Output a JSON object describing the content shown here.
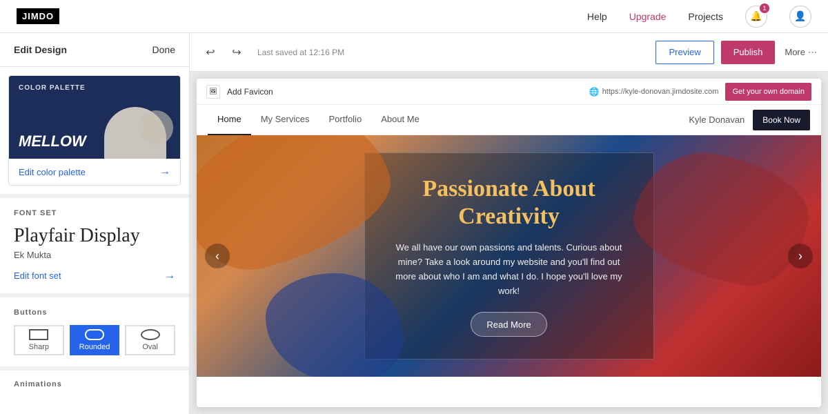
{
  "topnav": {
    "logo": "JIMDO",
    "help": "Help",
    "upgrade": "Upgrade",
    "projects": "Projects",
    "notification_count": "1"
  },
  "left_panel": {
    "header_title": "Edit Design",
    "done_label": "Done",
    "color_palette": {
      "section_label": "COLOR PALETTE",
      "palette_name": "MELLOW",
      "edit_link": "Edit color palette"
    },
    "font_set": {
      "section_label": "FONT SET",
      "primary_font": "Playfair Display",
      "secondary_font": "Ek Mukta",
      "edit_link": "Edit font set"
    },
    "buttons": {
      "section_label": "Buttons",
      "options": [
        {
          "id": "sharp",
          "label": "Sharp",
          "active": false
        },
        {
          "id": "rounded",
          "label": "Rounded",
          "active": true
        },
        {
          "id": "oval",
          "label": "Oval",
          "active": false
        }
      ]
    },
    "animations": {
      "section_label": "Animations"
    }
  },
  "preview_toolbar": {
    "saved_text": "Last saved at 12:16 PM",
    "preview_label": "Preview",
    "publish_label": "Publish",
    "more_label": "More"
  },
  "website": {
    "add_favicon": "Add Favicon",
    "site_url": "https://kyle-donovan.jimdosite.com",
    "get_domain": "Get your own domain",
    "nav_items": [
      "Home",
      "My Services",
      "Portfolio",
      "About Me"
    ],
    "nav_name": "Kyle Donavan",
    "book_now": "Book Now",
    "hero_title": "Passionate About Creativity",
    "hero_text": "We all have our own passions and talents. Curious about mine? Take a look around my website and you'll find out more about who I am and what I do. I hope you'll love my work!",
    "hero_cta": "Read More"
  }
}
